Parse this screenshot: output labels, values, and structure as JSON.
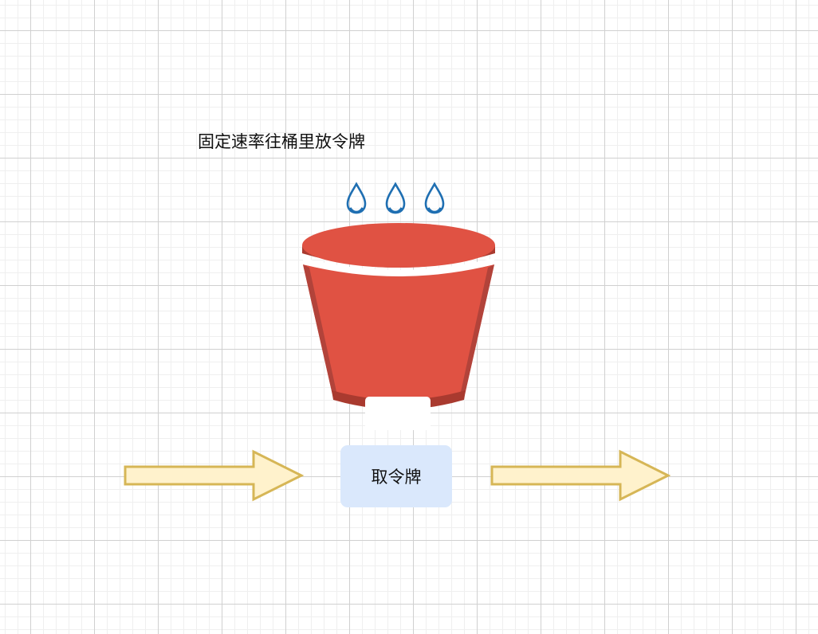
{
  "caption": "固定速率往桶里放令牌",
  "take_box": {
    "label": "取令牌"
  },
  "drops": [
    {
      "icon": "water-drop-icon"
    },
    {
      "icon": "water-drop-icon"
    },
    {
      "icon": "water-drop-icon"
    }
  ],
  "bucket": {
    "icon": "bucket-icon"
  },
  "arrows": [
    {
      "icon": "right-arrow-icon",
      "role": "input"
    },
    {
      "icon": "right-arrow-icon",
      "role": "output"
    }
  ],
  "colors": {
    "bucket_body": "#e05243",
    "bucket_dark": "#a93a2f",
    "drop_stroke": "#1f6fb2",
    "arrow_fill": "#fff2cc",
    "arrow_stroke": "#d6b656",
    "box_fill": "#dae8fc"
  }
}
